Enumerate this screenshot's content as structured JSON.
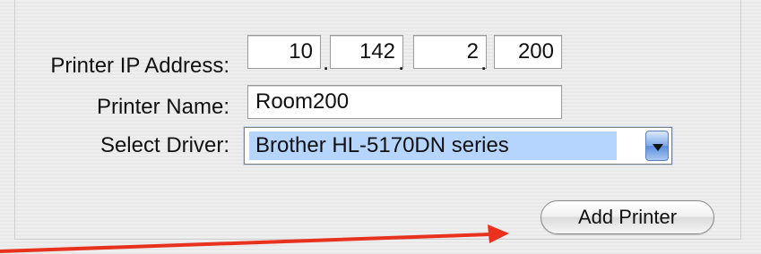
{
  "labels": {
    "ip_address": "Printer IP Address:",
    "printer_name": "Printer Name:",
    "select_driver": "Select Driver:"
  },
  "ip_octets": [
    "10",
    "142",
    "2",
    "200"
  ],
  "ip_separator": ".",
  "printer_name_value": "Room200",
  "driver_selected": "Brother HL-5170DN series",
  "add_printer_label": "Add Printer",
  "colors": {
    "annotation_arrow": "#e8321e",
    "selection_highlight": "#b5d5ff"
  },
  "icons": {
    "select_arrow": "chevron-down-icon",
    "annotation": "red-arrow-icon"
  }
}
